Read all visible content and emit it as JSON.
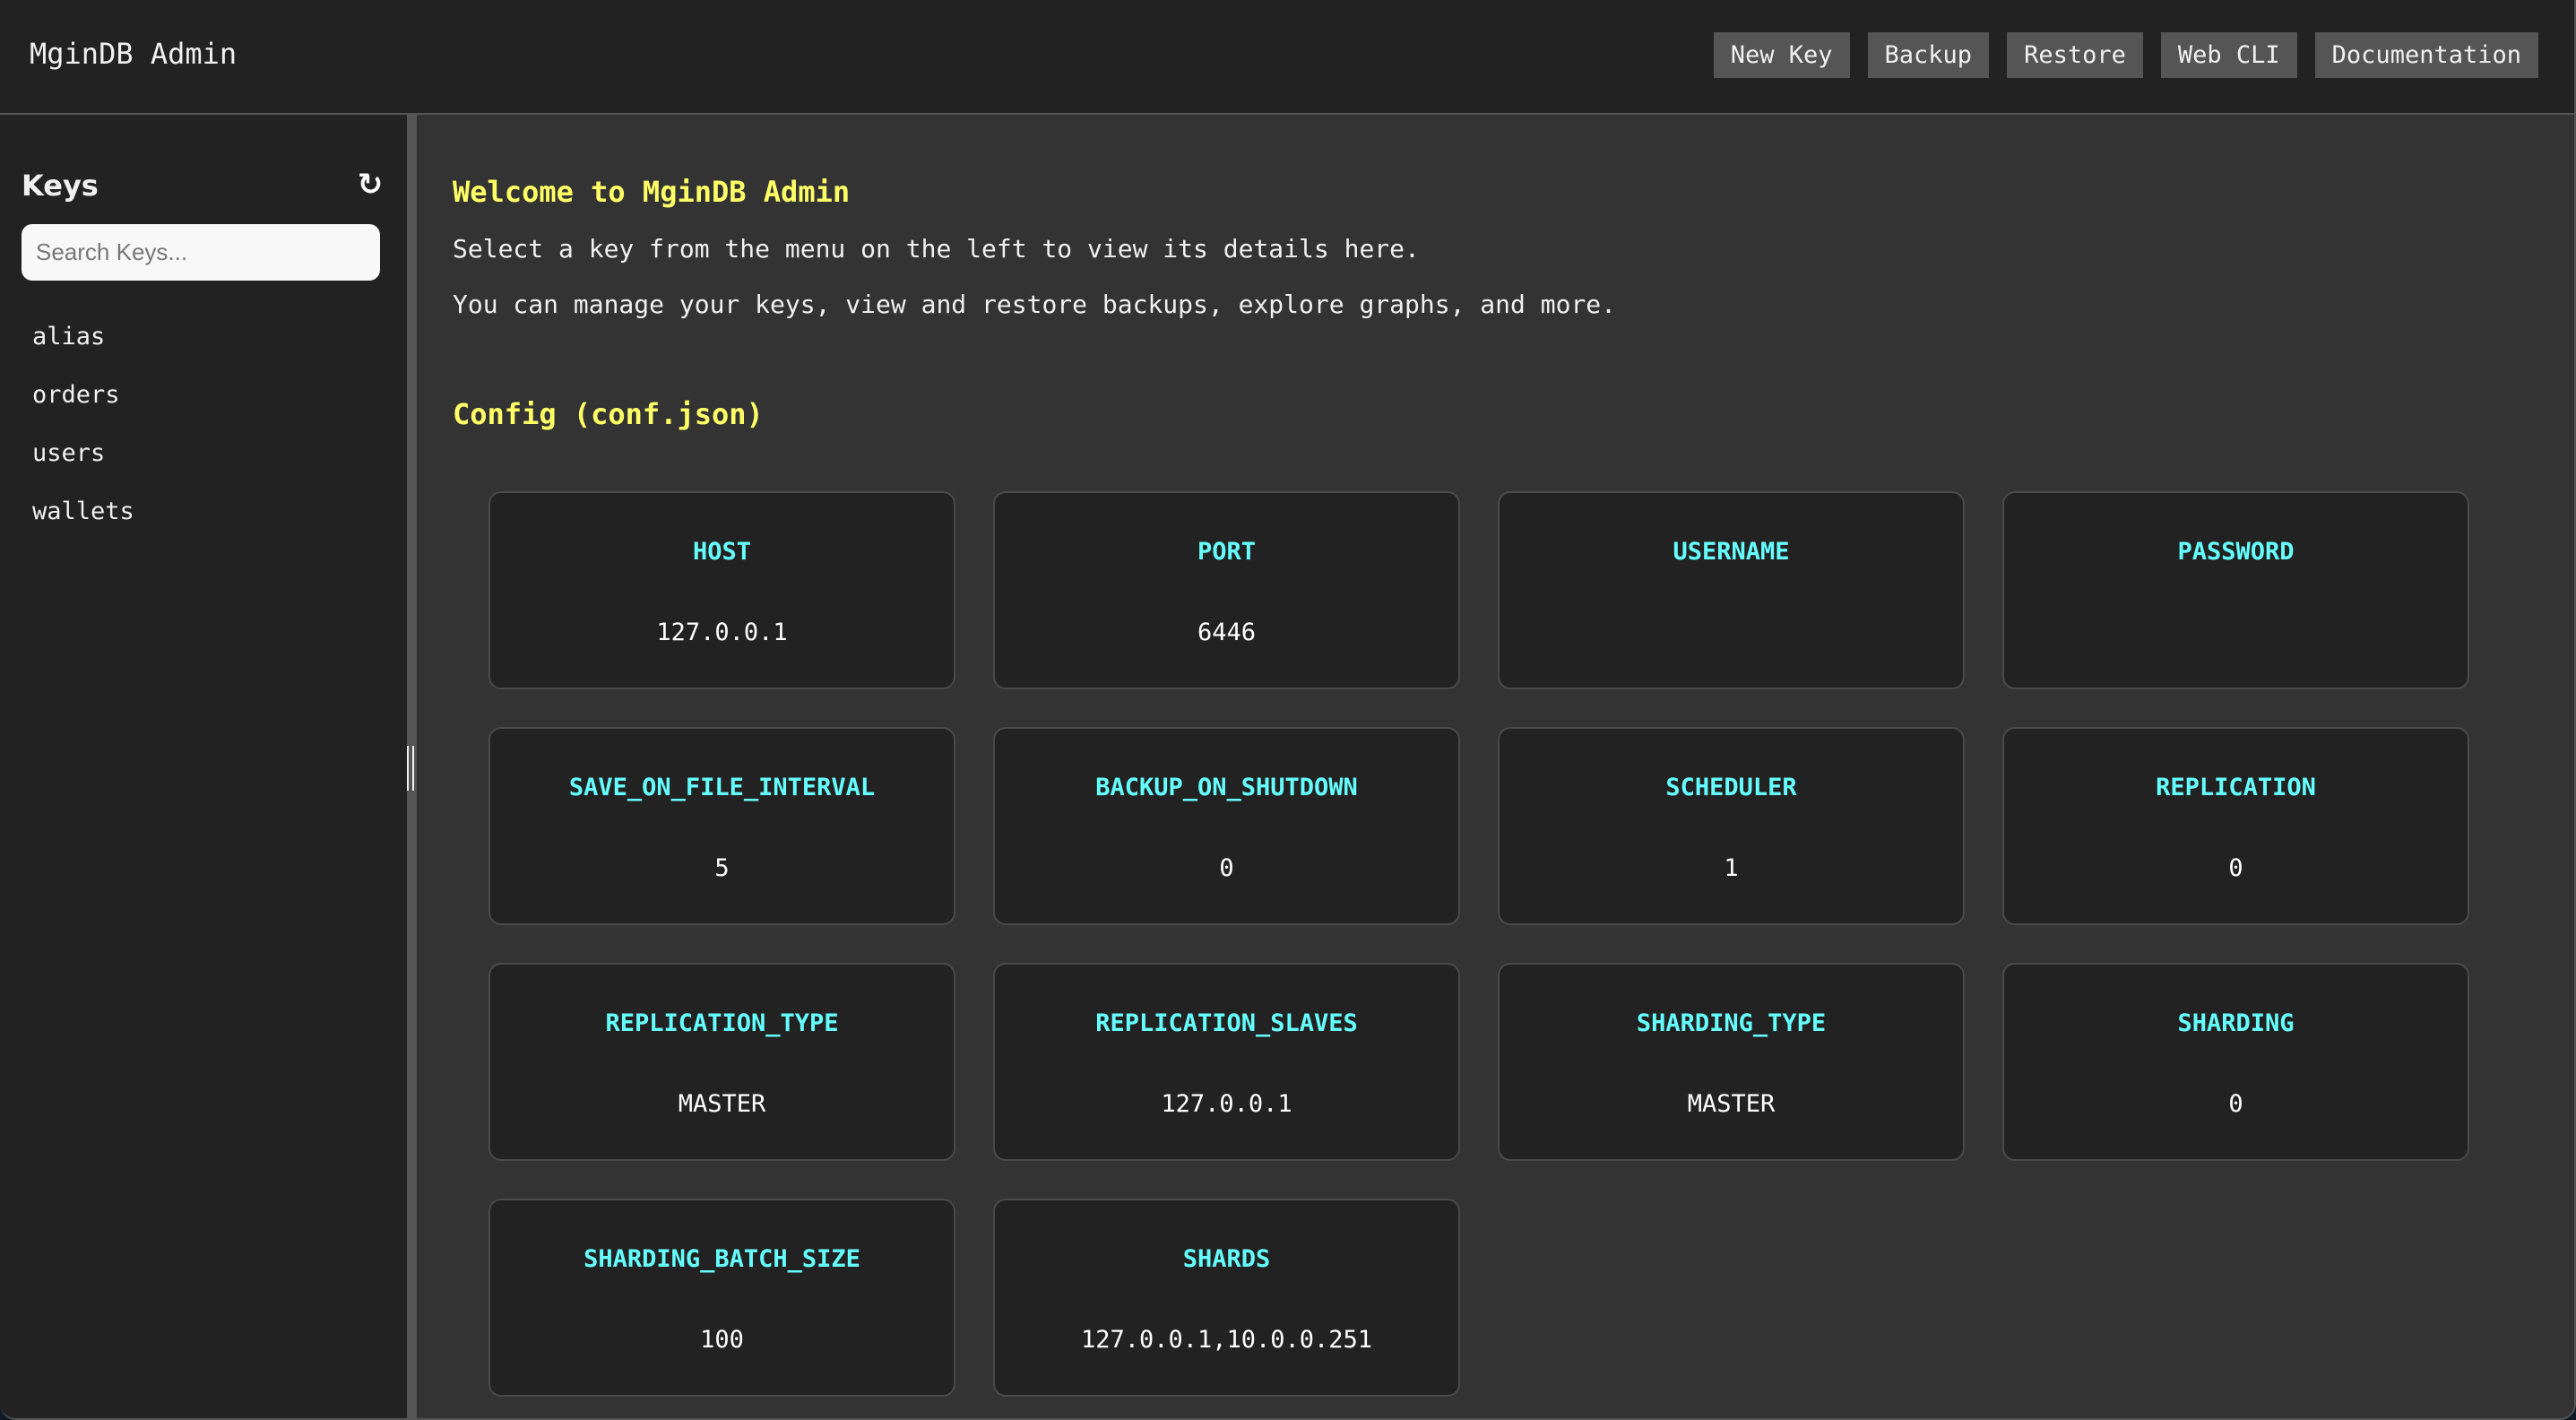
{
  "header": {
    "title": "MginDB Admin",
    "buttons": [
      {
        "label": "New Key"
      },
      {
        "label": "Backup"
      },
      {
        "label": "Restore"
      },
      {
        "label": "Web CLI"
      },
      {
        "label": "Documentation"
      }
    ]
  },
  "sidebar": {
    "title": "Keys",
    "refresh_icon": "↻",
    "search_placeholder": "Search Keys...",
    "search_value": "",
    "keys": [
      "alias",
      "orders",
      "users",
      "wallets"
    ]
  },
  "main": {
    "welcome_title": "Welcome to MginDB Admin",
    "paragraphs": [
      "Select a key from the menu on the left to view its details here.",
      "You can manage your keys, view and restore backups, explore graphs, and more."
    ],
    "config_title": "Config (conf.json)",
    "config": [
      {
        "label": "HOST",
        "value": "127.0.0.1"
      },
      {
        "label": "PORT",
        "value": "6446"
      },
      {
        "label": "USERNAME",
        "value": ""
      },
      {
        "label": "PASSWORD",
        "value": ""
      },
      {
        "label": "SAVE_ON_FILE_INTERVAL",
        "value": "5"
      },
      {
        "label": "BACKUP_ON_SHUTDOWN",
        "value": "0"
      },
      {
        "label": "SCHEDULER",
        "value": "1"
      },
      {
        "label": "REPLICATION",
        "value": "0"
      },
      {
        "label": "REPLICATION_TYPE",
        "value": "MASTER"
      },
      {
        "label": "REPLICATION_SLAVES",
        "value": "127.0.0.1"
      },
      {
        "label": "SHARDING_TYPE",
        "value": "MASTER"
      },
      {
        "label": "SHARDING",
        "value": "0"
      },
      {
        "label": "SHARDING_BATCH_SIZE",
        "value": "100"
      },
      {
        "label": "SHARDS",
        "value": "127.0.0.1,10.0.0.251"
      }
    ]
  },
  "colors": {
    "accent_heading": "#ffff66",
    "config_label": "#66ffff",
    "panel_bg": "#222222",
    "content_bg": "#333333",
    "button_bg": "#555555"
  }
}
